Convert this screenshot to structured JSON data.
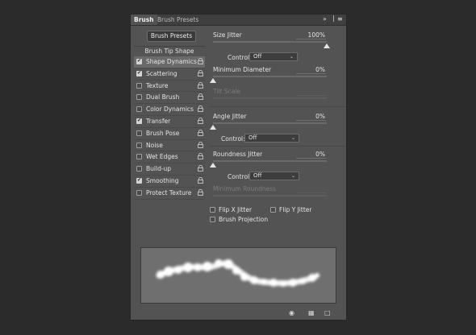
{
  "tabs": [
    {
      "label": "Brush",
      "active": true
    },
    {
      "label": "Brush Presets",
      "active": false
    }
  ],
  "tabbar_icons": [
    "collapse-icon",
    "panel-menu-icon"
  ],
  "brush_presets_button": "Brush Presets",
  "brush_tip_shape": "Brush Tip Shape",
  "list": [
    {
      "label": "Shape Dynamics",
      "checked": true,
      "selected": true
    },
    {
      "label": "Scattering",
      "checked": true,
      "selected": false
    },
    {
      "label": "Texture",
      "checked": false,
      "selected": false
    },
    {
      "label": "Dual Brush",
      "checked": false,
      "selected": false
    },
    {
      "label": "Color Dynamics",
      "checked": false,
      "selected": false
    },
    {
      "label": "Transfer",
      "checked": true,
      "selected": false
    },
    {
      "label": "Brush Pose",
      "checked": false,
      "selected": false
    },
    {
      "label": "Noise",
      "checked": false,
      "selected": false
    },
    {
      "label": "Wet Edges",
      "checked": false,
      "selected": false
    },
    {
      "label": "Build-up",
      "checked": false,
      "selected": false
    },
    {
      "label": "Smoothing",
      "checked": true,
      "selected": false
    },
    {
      "label": "Protect Texture",
      "checked": false,
      "selected": false
    }
  ],
  "size_jitter": {
    "label": "Size Jitter",
    "value": "100%",
    "fraction": 1.0
  },
  "control_label": "Control:",
  "control_value": "Off",
  "minimum_diameter": {
    "label": "Minimum Diameter",
    "value": "0%",
    "fraction": 0.0
  },
  "tilt_scale": {
    "label": "Tilt Scale"
  },
  "angle_jitter": {
    "label": "Angle Jitter",
    "value": "0%",
    "fraction": 0.0
  },
  "roundness_jitter": {
    "label": "Roundness Jitter",
    "value": "0%",
    "fraction": 0.0
  },
  "minimum_roundness": {
    "label": "Minimum Roundness"
  },
  "flip_x": {
    "label": "Flip X Jitter",
    "checked": false
  },
  "flip_y": {
    "label": "Flip Y Jitter",
    "checked": false
  },
  "brush_projection": {
    "label": "Brush Projection",
    "checked": false
  },
  "bottom_icons": [
    "toggle-live-tip-icon",
    "brush-preview-grid-icon",
    "create-new-brush-icon"
  ]
}
